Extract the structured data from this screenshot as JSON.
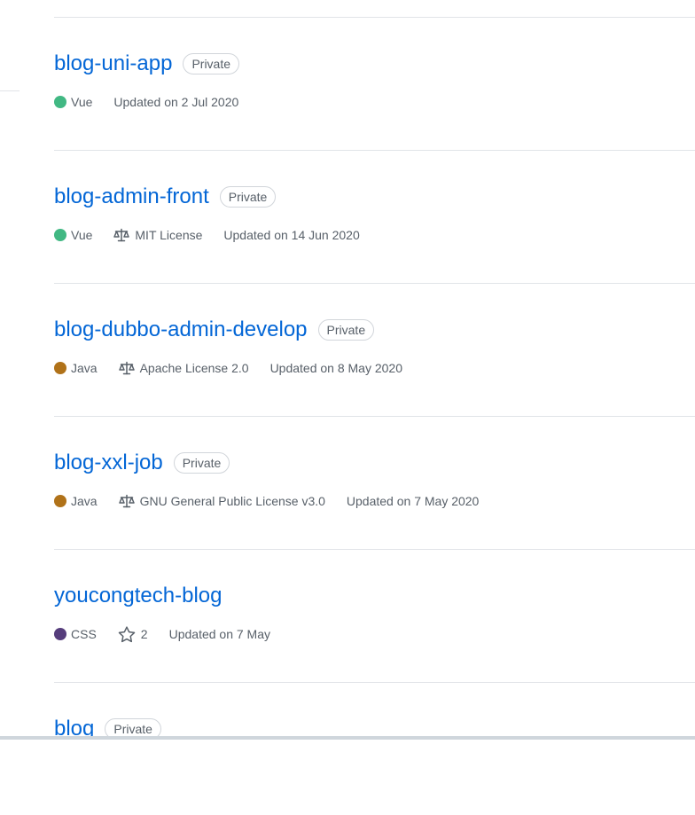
{
  "repos": [
    {
      "name": "blog-uni-app",
      "badge": "Private",
      "language": "Vue",
      "language_color": "#41b883",
      "license": "",
      "stars": "",
      "updated": "Updated on 2 Jul 2020"
    },
    {
      "name": "blog-admin-front",
      "badge": "Private",
      "language": "Vue",
      "language_color": "#41b883",
      "license": "MIT License",
      "stars": "",
      "updated": "Updated on 14 Jun 2020"
    },
    {
      "name": "blog-dubbo-admin-develop",
      "badge": "Private",
      "language": "Java",
      "language_color": "#b07219",
      "license": "Apache License 2.0",
      "stars": "",
      "updated": "Updated on 8 May 2020"
    },
    {
      "name": "blog-xxl-job",
      "badge": "Private",
      "language": "Java",
      "language_color": "#b07219",
      "license": "GNU General Public License v3.0",
      "stars": "",
      "updated": "Updated on 7 May 2020"
    },
    {
      "name": "youcongtech-blog",
      "badge": "",
      "language": "CSS",
      "language_color": "#563d7c",
      "license": "",
      "stars": "2",
      "updated": "Updated on 7 May"
    },
    {
      "name": "blog",
      "badge": "Private",
      "language": "",
      "language_color": "",
      "license": "",
      "stars": "",
      "updated": ""
    }
  ],
  "icons": {
    "license": "law-scale-icon",
    "stars": "star-icon"
  }
}
